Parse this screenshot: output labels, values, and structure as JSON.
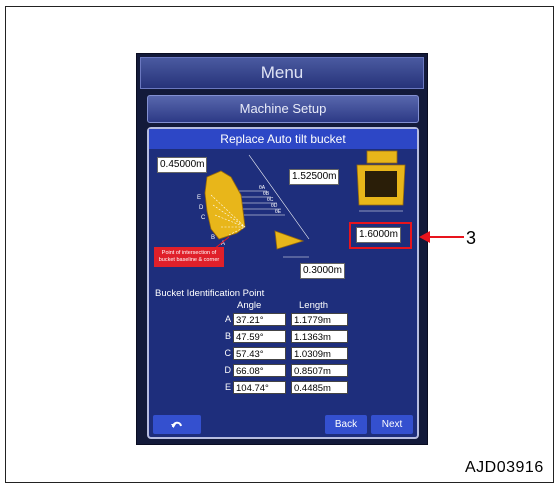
{
  "menu": {
    "title": "Menu"
  },
  "machine_setup": {
    "title": "Machine Setup"
  },
  "panel": {
    "title": "Replace Auto tilt bucket",
    "value_top_left": "0.45000m",
    "value_top_right": "1.52500m",
    "value_right": "1.6000m",
    "value_bottom": "0.3000m",
    "note_text": "Point of intersection of bucket baseline & corner",
    "diagram_letters": [
      "E",
      "D",
      "C",
      "B",
      "A"
    ],
    "theta_labels": [
      "θA",
      "θB",
      "θC",
      "θD",
      "θE"
    ]
  },
  "identification": {
    "title": "Bucket Identification Point",
    "headers": {
      "angle": "Angle",
      "length": "Length"
    },
    "rows": [
      {
        "letter": "A",
        "angle": "37.21°",
        "length": "1.1779m"
      },
      {
        "letter": "B",
        "angle": "47.59°",
        "length": "1.1363m"
      },
      {
        "letter": "C",
        "angle": "57.43°",
        "length": "1.0309m"
      },
      {
        "letter": "D",
        "angle": "66.08°",
        "length": "0.8507m"
      },
      {
        "letter": "E",
        "angle": "104.74°",
        "length": "0.4485m"
      }
    ]
  },
  "buttons": {
    "back": "Back",
    "next": "Next"
  },
  "annotations": {
    "callout": "3",
    "figure_code": "AJD03916"
  },
  "colors": {
    "highlight": "#e8141d",
    "panel": "#1e2e7c",
    "button": "#3450cf",
    "bucket": "#e8b61a"
  }
}
